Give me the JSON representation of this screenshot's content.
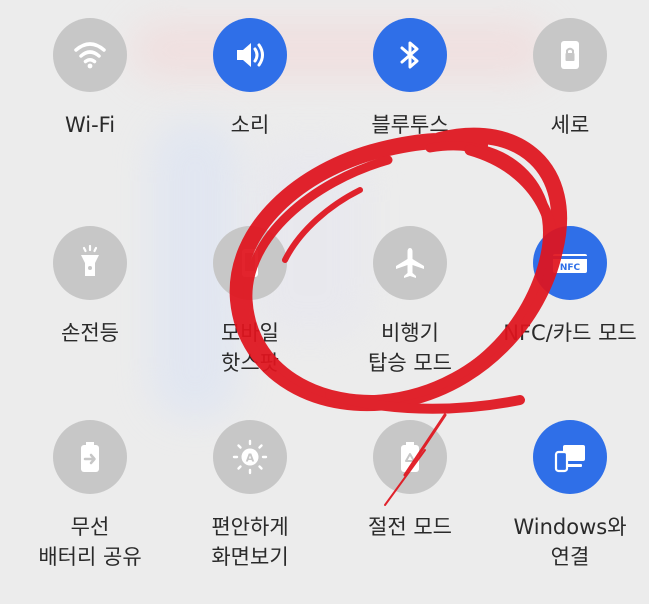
{
  "tiles": [
    {
      "label": "Wi-Fi",
      "icon": "wifi-icon",
      "active": false
    },
    {
      "label": "소리",
      "icon": "sound-icon",
      "active": true
    },
    {
      "label": "블루투스",
      "icon": "bluetooth-icon",
      "active": true
    },
    {
      "label": "세로",
      "icon": "portrait-lock-icon",
      "active": false
    },
    {
      "label": "손전등",
      "icon": "flashlight-icon",
      "active": false
    },
    {
      "label": "모바일\n핫스팟",
      "icon": "hotspot-icon",
      "active": false
    },
    {
      "label": "비행기\n탑승 모드",
      "icon": "airplane-icon",
      "active": false
    },
    {
      "label": "NFC/카드 모드",
      "icon": "nfc-icon",
      "active": true
    },
    {
      "label": "무선\n배터리 공유",
      "icon": "battery-share-icon",
      "active": false
    },
    {
      "label": "편안하게\n화면보기",
      "icon": "eye-comfort-icon",
      "active": false
    },
    {
      "label": "절전 모드",
      "icon": "power-saving-icon",
      "active": false
    },
    {
      "label": "Windows와\n연결",
      "icon": "link-to-windows-icon",
      "active": true
    }
  ],
  "nfc_badge": "NFC",
  "colors": {
    "active": "#2f6fe8",
    "inactive": "#c7c7c7",
    "scribble": "#e0141e"
  }
}
